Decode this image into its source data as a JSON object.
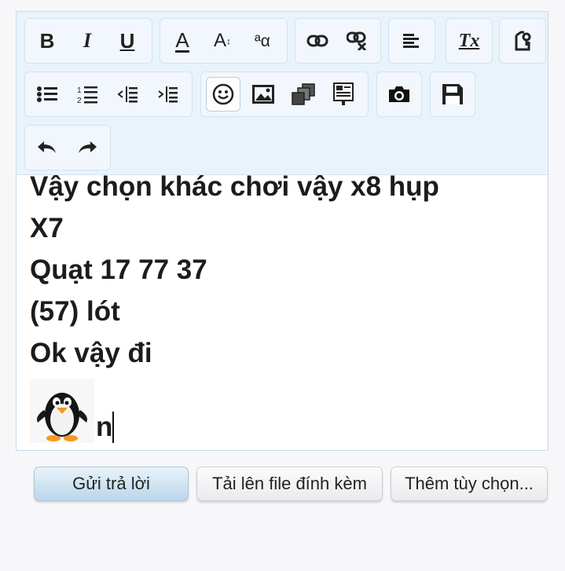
{
  "content_lines": [
    "Vậy chọn khác chơi vậy x8 hụp",
    "X7",
    "Quạt 17 77 37",
    "(57) lót",
    "Ok vậy đi"
  ],
  "typed_text": "n",
  "toolbar": {
    "bold": "B",
    "italic": "I",
    "underline": "U",
    "font_color": "A",
    "font_size": "A",
    "font_size_sup": "↕",
    "font_family": "ªα",
    "clear_format": "Tx"
  },
  "actions": {
    "reply": "Gửi trả lời",
    "upload": "Tải lên file đính kèm",
    "more": "Thêm tùy chọn..."
  }
}
